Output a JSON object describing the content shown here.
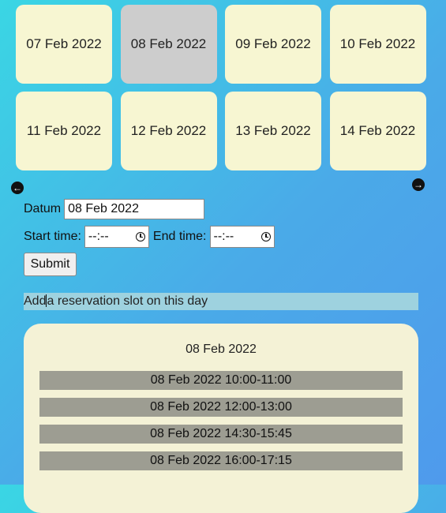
{
  "dates": [
    {
      "label": "07 Feb 2022",
      "selected": false
    },
    {
      "label": "08 Feb 2022",
      "selected": true
    },
    {
      "label": "09 Feb 2022",
      "selected": false
    },
    {
      "label": "10 Feb 2022",
      "selected": false
    },
    {
      "label": "11 Feb 2022",
      "selected": false
    },
    {
      "label": "12 Feb 2022",
      "selected": false
    },
    {
      "label": "13 Feb 2022",
      "selected": false
    },
    {
      "label": "14 Feb 2022",
      "selected": false
    }
  ],
  "nav": {
    "prev_icon": "arrow-left-circle-icon",
    "next_icon": "arrow-right-circle-icon"
  },
  "form": {
    "datum_label": "Datum",
    "datum_value": "08 Feb 2022",
    "start_label": "Start time:",
    "start_value": "--:--",
    "end_label": "End time:",
    "end_value": "--:--",
    "time_icon": "clock-icon",
    "submit_label": "Submit"
  },
  "add_slot": {
    "before_caret": "Add",
    "after_caret": "a reservation slot on this day"
  },
  "day_panel": {
    "title": "08 Feb 2022",
    "slots": [
      "08 Feb 2022 10:00-11:00",
      "08 Feb 2022 12:00-13:00",
      "08 Feb 2022 14:30-15:45",
      "08 Feb 2022 16:00-17:15"
    ]
  },
  "colors": {
    "tile": "#f7f6d2",
    "tile_selected": "#cdcdcd",
    "slot": "#9d9d92",
    "add_slot_bg": "#9ed2df",
    "panel": "#f4f2d6"
  }
}
